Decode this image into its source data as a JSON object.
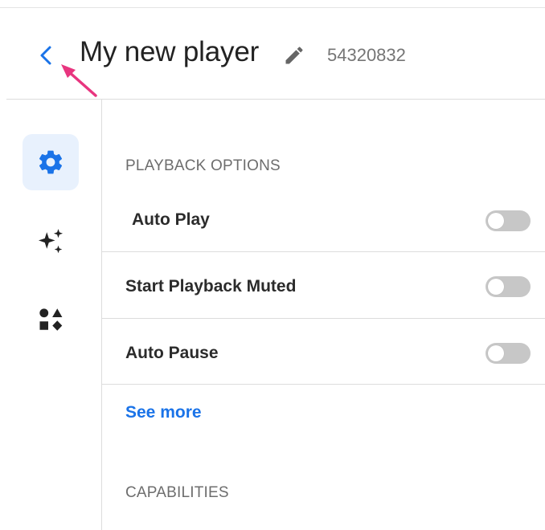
{
  "header": {
    "back_icon": "chevron-left-icon",
    "title": "My new player",
    "edit_icon": "pencil-icon",
    "player_id": "54320832"
  },
  "annotation": {
    "icon": "arrow-pointer-annotation",
    "color": "#e8357f"
  },
  "sidebar": {
    "items": [
      {
        "name": "settings",
        "icon": "gear-icon",
        "active": true
      },
      {
        "name": "ai-features",
        "icon": "sparkles-icon",
        "active": false
      },
      {
        "name": "plugins",
        "icon": "shapes-icon",
        "active": false
      }
    ]
  },
  "playback_options": {
    "section_title": "PLAYBACK OPTIONS",
    "options": [
      {
        "label": "Auto Play",
        "enabled": false
      },
      {
        "label": "Start Playback Muted",
        "enabled": false
      },
      {
        "label": "Auto Pause",
        "enabled": false
      }
    ],
    "see_more": "See more"
  },
  "capabilities": {
    "section_title": "CAPABILITIES"
  },
  "colors": {
    "accent": "#1a73e8",
    "active_bg": "#e8f1fd",
    "toggle_off": "#c7c7c7",
    "divider": "#dcdcdc"
  }
}
